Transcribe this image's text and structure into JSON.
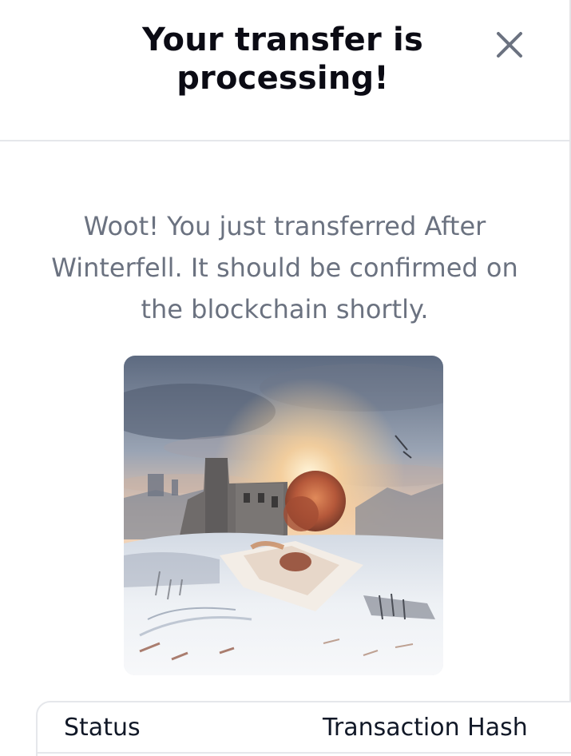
{
  "dialog": {
    "title": "Your transfer is processing!",
    "close_icon": "close-icon"
  },
  "message": "Woot! You just transferred After Winterfell. It should be confirmed on the blockchain shortly.",
  "nft": {
    "image_icon": "nft-artwork-image"
  },
  "table": {
    "columns": [
      "Status",
      "Transaction Hash"
    ]
  },
  "colors": {
    "title": "#0b0b14",
    "message": "#6b7280",
    "border": "#e5e7eb",
    "close_icon": "#6b7280"
  }
}
